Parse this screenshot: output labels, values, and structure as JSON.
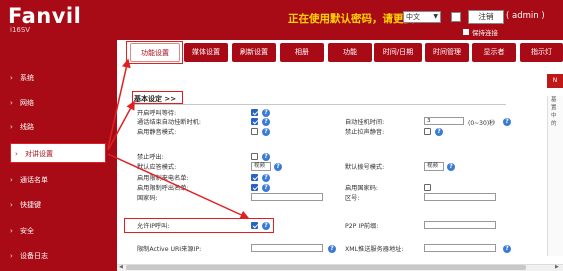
{
  "header": {
    "logo": "Fanvil",
    "model": "i16SV",
    "warning": "正在使用默认密码，请更换",
    "language": "中文",
    "logout_label": "注销",
    "user": "( admin )",
    "keep_online": "保持连接"
  },
  "tabs": [
    "功能设置",
    "媒体设置",
    "刷新设置",
    "相册",
    "功能",
    "时间/日期",
    "时间管理",
    "显示者",
    "指示灯"
  ],
  "active_tab": 0,
  "sidebar": {
    "items": [
      {
        "label": "系统"
      },
      {
        "label": "网络"
      },
      {
        "label": "线路"
      },
      {
        "label": "对讲设置"
      },
      {
        "label": "通话名单"
      },
      {
        "label": "快捷键"
      },
      {
        "label": "安全"
      },
      {
        "label": "设备日志"
      }
    ],
    "active_index": 3
  },
  "main": {
    "section_title": "基本设定 >>",
    "left_fields": [
      {
        "label": "开启呼叫等待:",
        "checked": true
      },
      {
        "label": "通话结束自动挂断时机:",
        "checked": true
      },
      {
        "label": "启用静音模式:",
        "checked": false
      },
      {
        "label": "禁止呼出:",
        "checked": false
      },
      {
        "label": "默认应答模式:",
        "select": "视频"
      },
      {
        "label": "启用限制来电名单:",
        "checked": true
      },
      {
        "label": "启用限制呼出名单:",
        "checked": true
      },
      {
        "label": "国家码:",
        "input": ""
      },
      {
        "label": "允许IP呼叫:",
        "checked": true
      },
      {
        "label": "限制Active URI来源IP:",
        "input": ""
      }
    ],
    "right_fields": [
      {
        "label": "自动挂机时间:",
        "input": "3",
        "hint": "(0~30)秒"
      },
      {
        "label": "禁止拉声静音:",
        "checked": false
      },
      {
        "label": "默认拨号模式:",
        "select": "视频"
      },
      {
        "label": "启用国家码:",
        "checked": false
      },
      {
        "label": "区号:",
        "input": ""
      },
      {
        "label": "P2P IP前缀:",
        "input": ""
      },
      {
        "label": "XML推送服务器地址:",
        "input": ""
      }
    ]
  },
  "right_panel": {
    "tab": "N",
    "lines": [
      "基",
      "置",
      "中",
      "的"
    ]
  },
  "colors": {
    "brand": "#a80b16",
    "warning": "#ffd400",
    "annotation": "#e02020",
    "checkbox": "#2a63c4"
  }
}
